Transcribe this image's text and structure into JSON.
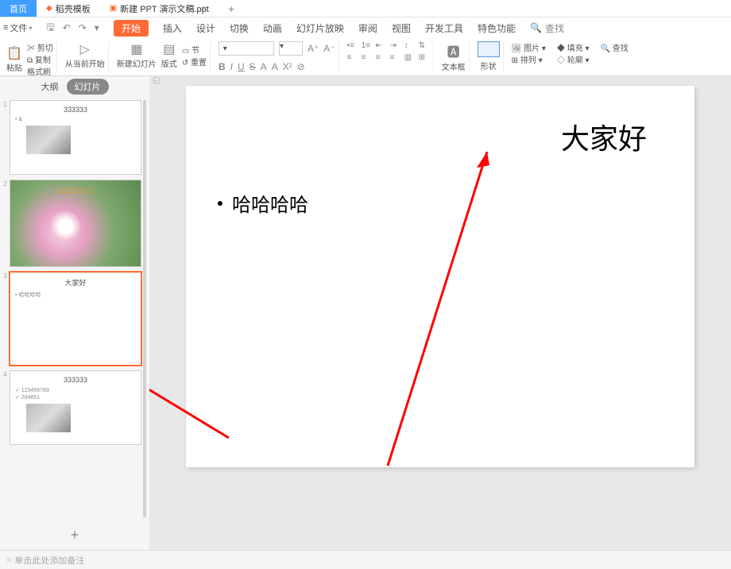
{
  "tabs": {
    "home": "首页",
    "template": "稻壳模板",
    "file": "新建 PPT 演示文稿.ppt",
    "close": "×",
    "restore": "⧉",
    "plus": "+"
  },
  "menu": {
    "file": "文件",
    "tri": "▾"
  },
  "ribbon_tabs": {
    "start": "开始",
    "insert": "插入",
    "design": "设计",
    "transition": "切换",
    "animation": "动画",
    "slideshow": "幻灯片放映",
    "review": "审阅",
    "view": "视图",
    "dev": "开发工具",
    "special": "特色功能",
    "search": "查找"
  },
  "toolbar": {
    "paste": "粘贴",
    "cut": "剪切",
    "copy": "复制",
    "format_painter": "格式刷",
    "from_current": "从当前开始",
    "new_slide": "新建幻灯片",
    "layout": "版式",
    "section": "节",
    "reset": "重置",
    "font_placeholder": "",
    "size_placeholder": "",
    "textbox": "文本框",
    "shape": "形状",
    "picture": "图片",
    "arrange": "排列",
    "fill": "填充",
    "outline": "轮廓",
    "find": "查找"
  },
  "fmt": {
    "bold": "B",
    "italic": "I",
    "underline": "U",
    "strike": "S",
    "fontA1": "A",
    "fontA2": "A",
    "fontA3": "A",
    "x2": "X²",
    "aplus": "A⁺",
    "aminus": "A⁻",
    "clear": "⊘"
  },
  "sidebar": {
    "outline": "大纲",
    "slides": "幻灯片",
    "plus": "+"
  },
  "thumbs": [
    {
      "num": "1",
      "title": "333333",
      "line1": "• &",
      "hasImg": true
    },
    {
      "num": "2",
      "title": "222222222",
      "flower": true
    },
    {
      "num": "3",
      "title": "大家好",
      "line1": "• 哈哈哈哈",
      "selected": true
    },
    {
      "num": "4",
      "title": "333333",
      "line1": "✓ 123456789",
      "line2": "✓ 284651",
      "hasImg": true
    }
  ],
  "slide": {
    "title": "大家好",
    "bullet1": "哈哈哈哈"
  },
  "notes": {
    "handle": "≡",
    "placeholder": "单击此处添加备注"
  }
}
